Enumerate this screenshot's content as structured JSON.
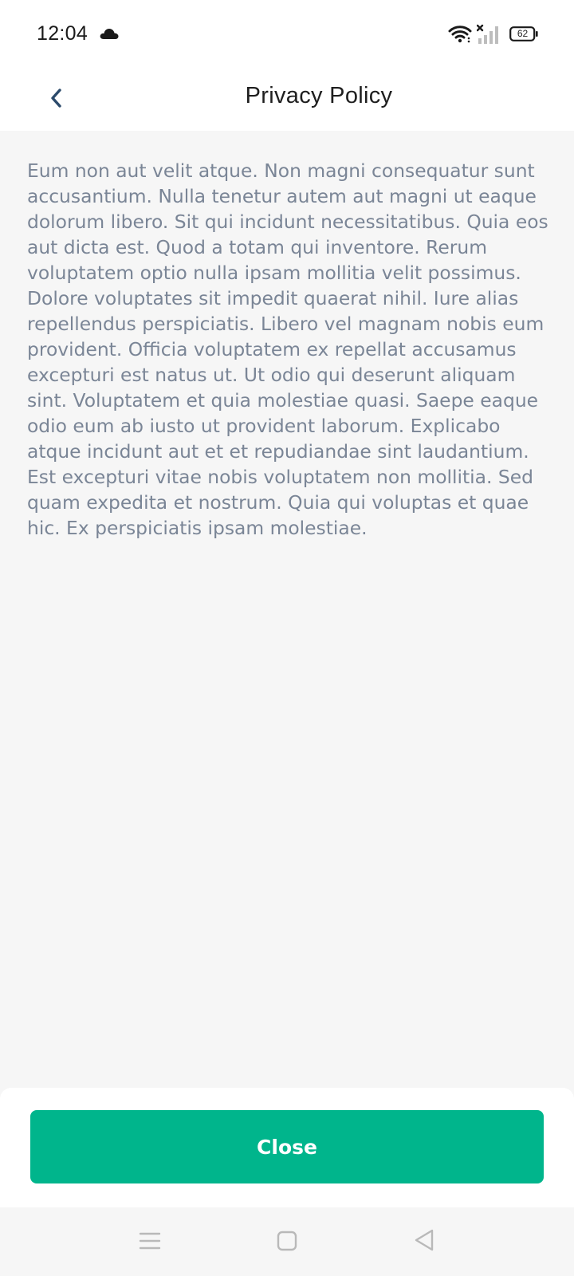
{
  "status_bar": {
    "time": "12:04",
    "battery_level": "62",
    "icons": [
      "cloud-icon",
      "wifi-icon",
      "signal-icon",
      "battery-icon"
    ]
  },
  "header": {
    "title": "Privacy Policy",
    "back_icon": "chevron-left-icon"
  },
  "content": {
    "body": "Eum non aut velit atque. Non magni consequatur sunt accusantium. Nulla tenetur autem aut magni ut eaque dolorum libero. Sit qui incidunt necessitatibus. Quia eos aut dicta est. Quod a totam qui inventore. Rerum voluptatem optio nulla ipsam mollitia velit possimus. Dolore voluptates sit impedit quaerat nihil. Iure alias repellendus perspiciatis. Libero vel magnam nobis eum provident. Officia voluptatem ex repellat accusamus excepturi est natus ut. Ut odio qui deserunt aliquam sint. Voluptatem et quia molestiae quasi. Saepe eaque odio eum ab iusto ut provident laborum. Explicabo atque incidunt aut et et repudiandae sint laudantium. Est excepturi vitae nobis voluptatem non mollitia. Sed quam expedita et nostrum. Quia qui voluptas et quae hic. Ex perspiciatis ipsam molestiae."
  },
  "footer": {
    "close_label": "Close"
  },
  "nav_bar": {
    "icons": [
      "menu-icon",
      "home-icon",
      "back-triangle-icon"
    ]
  },
  "colors": {
    "accent": "#00b58c",
    "body_text": "#7a8596",
    "background": "#f6f6f6",
    "header_icon": "#2c4a6b"
  }
}
